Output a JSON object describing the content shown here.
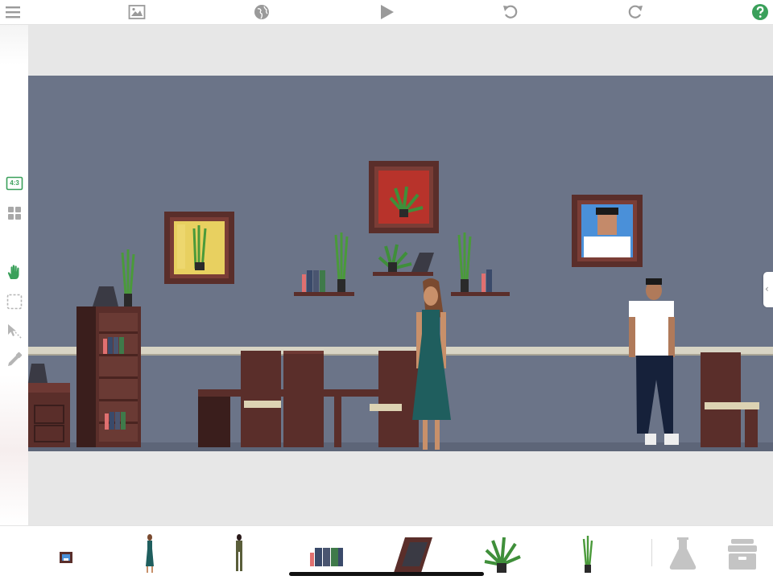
{
  "toolbar": {
    "items": [
      {
        "name": "menu",
        "icon": "hamburger-menu-icon"
      },
      {
        "name": "background",
        "icon": "image-icon"
      },
      {
        "name": "globe",
        "icon": "globe-icon"
      },
      {
        "name": "play",
        "icon": "play-icon"
      },
      {
        "name": "undo",
        "icon": "undo-icon"
      },
      {
        "name": "redo",
        "icon": "redo-icon"
      },
      {
        "name": "help",
        "icon": "help-icon"
      }
    ],
    "help_color": "#3aa05a"
  },
  "left_tools": {
    "aspect_ratio_label": "4:3",
    "items": [
      {
        "name": "aspect-ratio",
        "icon": "aspect-ratio-icon"
      },
      {
        "name": "grid",
        "icon": "grid-icon"
      },
      {
        "name": "pan-hand",
        "icon": "hand-icon",
        "active": true
      },
      {
        "name": "marquee-select",
        "icon": "dashed-select-icon"
      },
      {
        "name": "pointer-select",
        "icon": "pointer-icon"
      },
      {
        "name": "eyedropper",
        "icon": "eyedropper-icon"
      }
    ],
    "accent_color": "#3aa05a"
  },
  "scene": {
    "wall_color": "#6b7488",
    "floor_color": "#5d6578",
    "rail_color": "#d8d4c4",
    "furniture_color": "#5a2e2a",
    "characters": [
      {
        "name": "woman-in-teal-dress"
      },
      {
        "name": "man-in-white-tshirt"
      }
    ],
    "framed_art": [
      {
        "name": "yellow-plant-painting",
        "color": "#e8d060"
      },
      {
        "name": "red-plant-painting",
        "color": "#c0392b"
      },
      {
        "name": "portrait-man-painting",
        "color": "#4a90d9"
      }
    ]
  },
  "asset_tray": {
    "items": [
      {
        "name": "framed-picture",
        "icon": "framed-picture-icon"
      },
      {
        "name": "woman-teal-dress",
        "icon": "woman-figure-icon"
      },
      {
        "name": "woman-olive-outfit",
        "icon": "woman-figure-icon"
      },
      {
        "name": "books",
        "icon": "books-icon"
      },
      {
        "name": "photo-frame",
        "icon": "photo-frame-icon"
      },
      {
        "name": "fern-plant",
        "icon": "fern-icon"
      },
      {
        "name": "bamboo-plant",
        "icon": "bamboo-icon"
      }
    ],
    "utilities": [
      {
        "name": "flask",
        "icon": "flask-icon"
      },
      {
        "name": "archive",
        "icon": "archive-box-icon"
      }
    ]
  }
}
